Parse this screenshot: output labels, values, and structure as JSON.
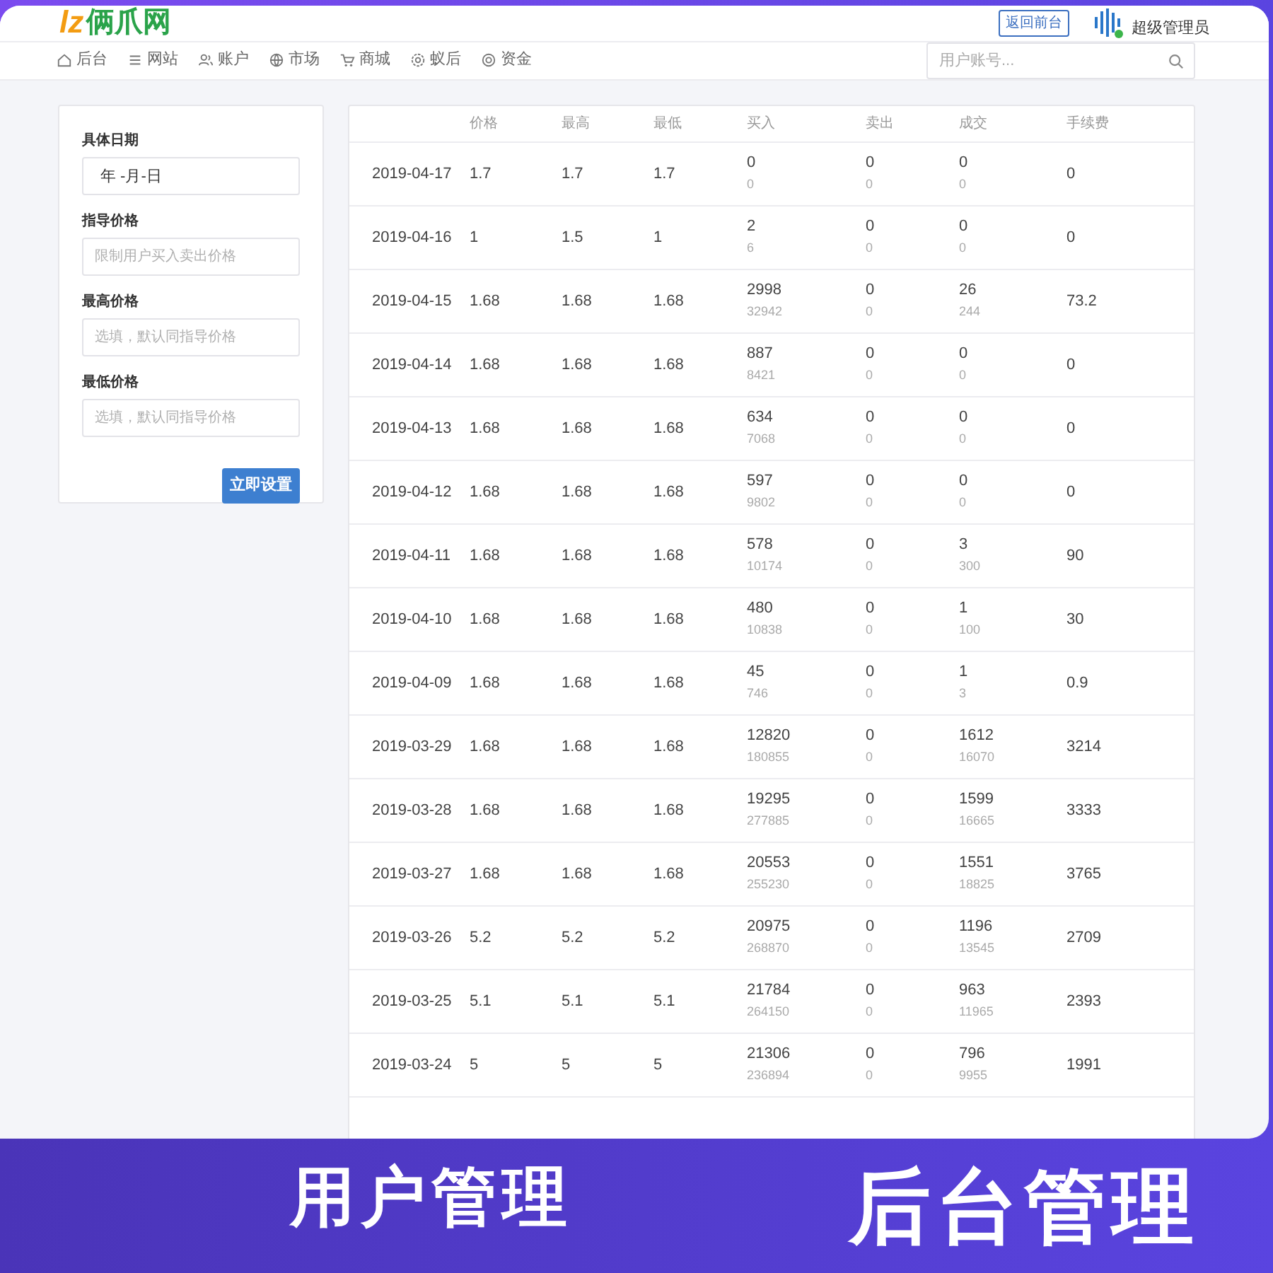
{
  "header": {
    "logo_mark": "lz",
    "logo_text": "俩爪网",
    "back_button": "返回前台",
    "user": "超级管理员"
  },
  "nav": [
    {
      "label": "后台",
      "selected": false
    },
    {
      "label": "网站",
      "selected": false
    },
    {
      "label": "账户",
      "selected": false
    },
    {
      "label": "市场",
      "selected": false
    },
    {
      "label": "商城",
      "selected": false
    },
    {
      "label": "蚁后",
      "selected": false
    },
    {
      "label": "资金",
      "selected": false
    }
  ],
  "search": {
    "placeholder": "用户账号..."
  },
  "form": {
    "fields": [
      {
        "label": "具体日期",
        "value": "年 -月-日"
      },
      {
        "label": "指导价格",
        "placeholder": "限制用户买入卖出价格"
      },
      {
        "label": "最高价格",
        "placeholder": "选填，默认同指导价格"
      },
      {
        "label": "最低价格",
        "placeholder": "选填，默认同指导价格"
      }
    ],
    "submit": "立即设置"
  },
  "table": {
    "columns": [
      "价格",
      "最高",
      "最低",
      "买入",
      "卖出",
      "成交",
      "手续费"
    ],
    "rows": [
      {
        "date": "2019-04-17",
        "price": "1.7",
        "high": "1.7",
        "low": "1.7",
        "buy": [
          "0",
          "0"
        ],
        "sell": [
          "0",
          "0"
        ],
        "deal": [
          "0",
          "0"
        ],
        "fee": "0"
      },
      {
        "date": "2019-04-16",
        "price": "1",
        "high": "1.5",
        "low": "1",
        "buy": [
          "2",
          "6"
        ],
        "sell": [
          "0",
          "0"
        ],
        "deal": [
          "0",
          "0"
        ],
        "fee": "0"
      },
      {
        "date": "2019-04-15",
        "price": "1.68",
        "high": "1.68",
        "low": "1.68",
        "buy": [
          "2998",
          "32942"
        ],
        "sell": [
          "0",
          "0"
        ],
        "deal": [
          "26",
          "244"
        ],
        "fee": "73.2"
      },
      {
        "date": "2019-04-14",
        "price": "1.68",
        "high": "1.68",
        "low": "1.68",
        "buy": [
          "887",
          "8421"
        ],
        "sell": [
          "0",
          "0"
        ],
        "deal": [
          "0",
          "0"
        ],
        "fee": "0"
      },
      {
        "date": "2019-04-13",
        "price": "1.68",
        "high": "1.68",
        "low": "1.68",
        "buy": [
          "634",
          "7068"
        ],
        "sell": [
          "0",
          "0"
        ],
        "deal": [
          "0",
          "0"
        ],
        "fee": "0"
      },
      {
        "date": "2019-04-12",
        "price": "1.68",
        "high": "1.68",
        "low": "1.68",
        "buy": [
          "597",
          "9802"
        ],
        "sell": [
          "0",
          "0"
        ],
        "deal": [
          "0",
          "0"
        ],
        "fee": "0"
      },
      {
        "date": "2019-04-11",
        "price": "1.68",
        "high": "1.68",
        "low": "1.68",
        "buy": [
          "578",
          "10174"
        ],
        "sell": [
          "0",
          "0"
        ],
        "deal": [
          "3",
          "300"
        ],
        "fee": "90"
      },
      {
        "date": "2019-04-10",
        "price": "1.68",
        "high": "1.68",
        "low": "1.68",
        "buy": [
          "480",
          "10838"
        ],
        "sell": [
          "0",
          "0"
        ],
        "deal": [
          "1",
          "100"
        ],
        "fee": "30"
      },
      {
        "date": "2019-04-09",
        "price": "1.68",
        "high": "1.68",
        "low": "1.68",
        "buy": [
          "45",
          "746"
        ],
        "sell": [
          "0",
          "0"
        ],
        "deal": [
          "1",
          "3"
        ],
        "fee": "0.9"
      },
      {
        "date": "2019-03-29",
        "price": "1.68",
        "high": "1.68",
        "low": "1.68",
        "buy": [
          "12820",
          "180855"
        ],
        "sell": [
          "0",
          "0"
        ],
        "deal": [
          "1612",
          "16070"
        ],
        "fee": "3214"
      },
      {
        "date": "2019-03-28",
        "price": "1.68",
        "high": "1.68",
        "low": "1.68",
        "buy": [
          "19295",
          "277885"
        ],
        "sell": [
          "0",
          "0"
        ],
        "deal": [
          "1599",
          "16665"
        ],
        "fee": "3333"
      },
      {
        "date": "2019-03-27",
        "price": "1.68",
        "high": "1.68",
        "low": "1.68",
        "buy": [
          "20553",
          "255230"
        ],
        "sell": [
          "0",
          "0"
        ],
        "deal": [
          "1551",
          "18825"
        ],
        "fee": "3765"
      },
      {
        "date": "2019-03-26",
        "price": "5.2",
        "high": "5.2",
        "low": "5.2",
        "buy": [
          "20975",
          "268870"
        ],
        "sell": [
          "0",
          "0"
        ],
        "deal": [
          "1196",
          "13545"
        ],
        "fee": "2709"
      },
      {
        "date": "2019-03-25",
        "price": "5.1",
        "high": "5.1",
        "low": "5.1",
        "buy": [
          "21784",
          "264150"
        ],
        "sell": [
          "0",
          "0"
        ],
        "deal": [
          "963",
          "11965"
        ],
        "fee": "2393"
      },
      {
        "date": "2019-03-24",
        "price": "5",
        "high": "5",
        "low": "5",
        "buy": [
          "21306",
          "236894"
        ],
        "sell": [
          "0",
          "0"
        ],
        "deal": [
          "796",
          "9955"
        ],
        "fee": "1991"
      }
    ]
  },
  "banner": {
    "left": "用户管理",
    "right": "后台管理"
  }
}
